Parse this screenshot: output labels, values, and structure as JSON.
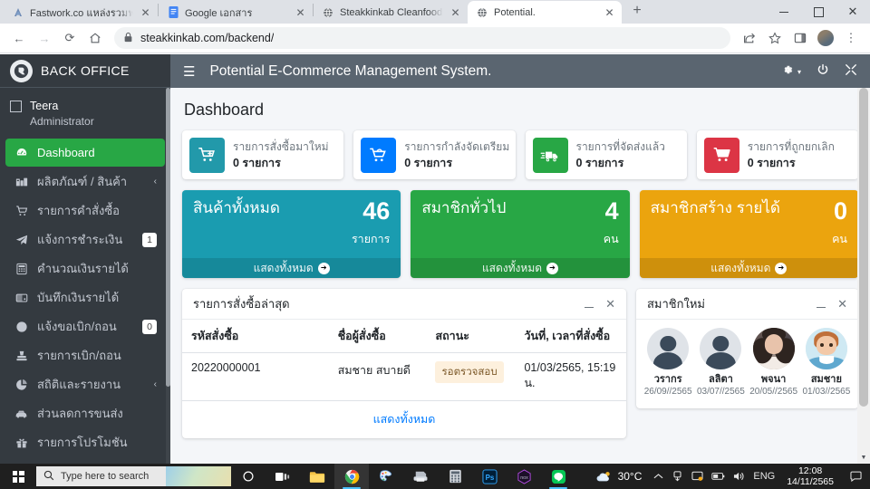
{
  "browser": {
    "tabs": [
      {
        "title": "Fastwork.co แหล่งรวมฟรีแลนซ์คุณภ...",
        "favicon": "fastwork-icon",
        "active": false
      },
      {
        "title": "Google เอกสาร",
        "favicon": "google-docs-icon",
        "active": false
      },
      {
        "title": "Steakkinkab Cleanfood.",
        "favicon": "globe-icon",
        "active": false
      },
      {
        "title": "Potential.",
        "favicon": "globe-icon",
        "active": true
      }
    ],
    "new_tab_label": "+",
    "window_controls": {
      "minimize": "—",
      "maximize": "□",
      "close": "✕"
    },
    "nav": {
      "back": "←",
      "forward": "→",
      "reload": "⟳",
      "home": "⌂"
    },
    "omnibox": {
      "lock": "🔒",
      "url": "steakkinkab.com/backend/"
    },
    "toolbar_icons": {
      "share": "share-icon",
      "bookmark": "star-icon",
      "sidepanel": "side-panel-icon",
      "menu": "⋮"
    }
  },
  "sidebar": {
    "brand": "BACK  OFFICE",
    "logo": "back-office-logo",
    "user": {
      "name": "Teera",
      "role": "Administrator"
    },
    "items": [
      {
        "label": "Dashboard",
        "icon": "dashboard-icon",
        "active": true,
        "arrow": "",
        "badge": ""
      },
      {
        "label": "ผลิตภัณฑ์ / สินค้า",
        "icon": "products-icon",
        "active": false,
        "arrow": "‹",
        "badge": ""
      },
      {
        "label": "รายการคำสั่งซื้อ",
        "icon": "cart-icon",
        "active": false,
        "arrow": "",
        "badge": ""
      },
      {
        "label": "แจ้งการชำระเงิน",
        "icon": "paper-plane-icon",
        "active": false,
        "arrow": "",
        "badge": "1"
      },
      {
        "label": "คำนวณเงินรายได้",
        "icon": "calculator-icon",
        "active": false,
        "arrow": "",
        "badge": ""
      },
      {
        "label": "บันทึกเงินรายได้",
        "icon": "wallet-icon",
        "active": false,
        "arrow": "",
        "badge": ""
      },
      {
        "label": "แจ้งขอเบิก/ถอน",
        "icon": "coin-icon",
        "active": false,
        "arrow": "",
        "badge": "0"
      },
      {
        "label": "รายการเบิก/ถอน",
        "icon": "stamp-icon",
        "active": false,
        "arrow": "",
        "badge": ""
      },
      {
        "label": "สถิติและรายงาน",
        "icon": "pie-chart-icon",
        "active": false,
        "arrow": "‹",
        "badge": ""
      },
      {
        "label": "ส่วนลดการขนส่ง",
        "icon": "car-icon",
        "active": false,
        "arrow": "",
        "badge": ""
      },
      {
        "label": "รายการโปรโมชัน",
        "icon": "gift-icon",
        "active": false,
        "arrow": "",
        "badge": ""
      }
    ]
  },
  "topbar": {
    "hamburger": "☰",
    "title": "Potential E-Commerce Management System.",
    "icons": [
      "gear-icon",
      "power-icon",
      "fullscreen-icon"
    ]
  },
  "main": {
    "page_title": "Dashboard",
    "info_boxes": [
      {
        "icon": "cart-plus-icon",
        "color": "#2299aa",
        "text": "รายการสั่งซื้อมาใหม่",
        "value": "0 รายการ"
      },
      {
        "icon": "cart-prepare-icon",
        "color": "#007bff",
        "text": "รายการกำลังจัดเตรียม",
        "value": "0 รายการ"
      },
      {
        "icon": "truck-icon",
        "color": "#28a745",
        "text": "รายการที่จัดส่งแล้ว",
        "value": "0 รายการ"
      },
      {
        "icon": "cart-cancel-icon",
        "color": "#dc3545",
        "text": "รายการที่ถูกยกเลิก",
        "value": "0 รายการ"
      }
    ],
    "stat_boxes": [
      {
        "title": "สินค้าทั้งหมด",
        "value": "46",
        "unit": "รายการ",
        "footer": "แสดงทั้งหมด",
        "color": "#1a9cb0"
      },
      {
        "title": "สมาชิกทั่วไป",
        "value": "4",
        "unit": "คน",
        "footer": "แสดงทั้งหมด",
        "color": "#28a745"
      },
      {
        "title": "สมาชิกสร้าง รายได้",
        "value": "0",
        "unit": "คน",
        "footer": "แสดงทั้งหมด",
        "color": "#eba40e"
      }
    ],
    "orders_card": {
      "title": "รายการสั่งซื้อล่าสุด",
      "minimize": "minimize-icon",
      "close": "close-icon",
      "columns": [
        "รหัสสั่งซื้อ",
        "ชื่อผู้สั่งซื้อ",
        "สถานะ",
        "วันที่, เวลาที่สั่งซื้อ"
      ],
      "rows": [
        {
          "code": "20220000001",
          "buyer": "สมชาย สบายดี",
          "status": "รอตรวจสอบ",
          "datetime": "01/03/2565, 15:19 น."
        }
      ],
      "show_all": "แสดงทั้งหมด"
    },
    "members_card": {
      "title": "สมาชิกใหม่",
      "minimize": "minimize-icon",
      "close": "close-icon",
      "members": [
        {
          "name": "วรากร",
          "date": "26/09//2565",
          "avatar": "silhouette"
        },
        {
          "name": "ลลิตา",
          "date": "03/07//2565",
          "avatar": "silhouette"
        },
        {
          "name": "พจนา",
          "date": "20/05//2565",
          "avatar": "photo"
        },
        {
          "name": "สมชาย",
          "date": "01/03//2565",
          "avatar": "cartoon"
        }
      ]
    }
  },
  "taskbar": {
    "start": "windows-logo",
    "search_placeholder": "Type here to search",
    "apps": [
      {
        "name": "cortana-icon"
      },
      {
        "name": "task-view-icon"
      },
      {
        "name": "file-explorer-icon"
      },
      {
        "name": "chrome-icon"
      },
      {
        "name": "paint-icon"
      },
      {
        "name": "printer-icon"
      },
      {
        "name": "calculator-icon"
      },
      {
        "name": "photoshop-icon"
      },
      {
        "name": "nox-icon"
      },
      {
        "name": "line-icon"
      }
    ],
    "weather": "30°C",
    "tray": [
      "chevron-up-icon",
      "onedrive-icon",
      "safety-icon",
      "battery-icon",
      "volume-icon"
    ],
    "language": "ENG",
    "time": "12:08",
    "date": "14/11/2565",
    "action_center": "notification-icon"
  }
}
